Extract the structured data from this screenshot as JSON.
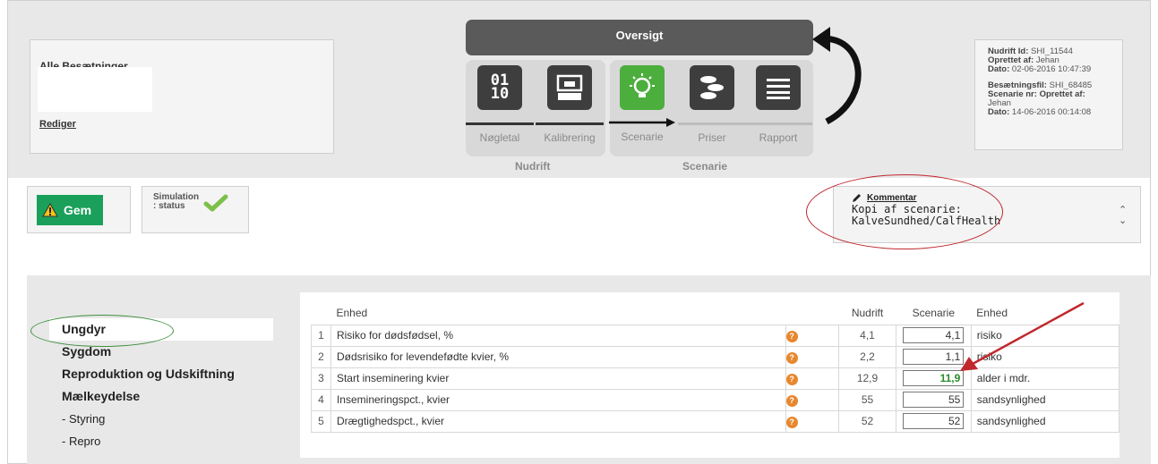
{
  "herd": {
    "title": "Alle Besætninger",
    "edit_link": "Rediger"
  },
  "overview": {
    "title": "Oversigt"
  },
  "tools": [
    {
      "label": "Nøgletal",
      "icon": "binary-icon"
    },
    {
      "label": "Kalibrering",
      "icon": "calibration-icon"
    },
    {
      "label": "Scenarie",
      "icon": "lightbulb-icon"
    },
    {
      "label": "Priser",
      "icon": "coins-icon"
    },
    {
      "label": "Rapport",
      "icon": "list-icon"
    }
  ],
  "groups": {
    "nudrift": "Nudrift",
    "scenarie": "Scenarie"
  },
  "info": {
    "nudrift_id_label": "Nudrift Id:",
    "nudrift_id": "SHI_11544",
    "created_by_label": "Oprettet af:",
    "created_by": "Jehan",
    "date_label": "Dato:",
    "date": "02-06-2016 10:47:39",
    "file_label": "Besætningsfil:",
    "file": "SHI_68485",
    "scenario_label": "Scenarie nr:",
    "scenario_created_label": "Oprettet af:",
    "scenario_created_by": "Jehan",
    "date2_label": "Dato:",
    "date2": "14-06-2016 00:14:08"
  },
  "save": {
    "label": "Gem"
  },
  "simulation": {
    "label": "Simulation : status"
  },
  "comment": {
    "link": "Kommentar",
    "text": "Kopi af scenarie:\nKalveSundhed/CalfHealth"
  },
  "sidebar": {
    "items": [
      {
        "label": "Ungdyr"
      },
      {
        "label": "Sygdom"
      },
      {
        "label": "Reproduktion og Udskiftning"
      },
      {
        "label": "Mælkeydelse"
      },
      {
        "label": "- Styring"
      },
      {
        "label": "- Repro"
      }
    ]
  },
  "table": {
    "headers": {
      "unit": "Enhed",
      "nudrift": "Nudrift",
      "scenarie": "Scenarie",
      "unit2": "Enhed"
    },
    "rows": [
      {
        "n": "1",
        "name": "Risiko for dødsfødsel, %",
        "nudrift": "4,1",
        "scenarie": "4,1",
        "unit": "risiko"
      },
      {
        "n": "2",
        "name": "Dødsrisiko for levendefødte kvier, %",
        "nudrift": "2,2",
        "scenarie": "1,1",
        "unit": "risiko"
      },
      {
        "n": "3",
        "name": "Start inseminering kvier",
        "nudrift": "12,9",
        "scenarie": "11,9",
        "unit": "alder i mdr."
      },
      {
        "n": "4",
        "name": "Insemineringspct., kvier",
        "nudrift": "55",
        "scenarie": "55",
        "unit": "sandsynlighed"
      },
      {
        "n": "5",
        "name": "Drægtighedspct., kvier",
        "nudrift": "52",
        "scenarie": "52",
        "unit": "sandsynlighed"
      }
    ]
  },
  "colors": {
    "green": "#1aa05a",
    "highlight": "#2a8c2a",
    "annotation_red": "#c0282d",
    "annotation_green": "#3e8f3e"
  }
}
